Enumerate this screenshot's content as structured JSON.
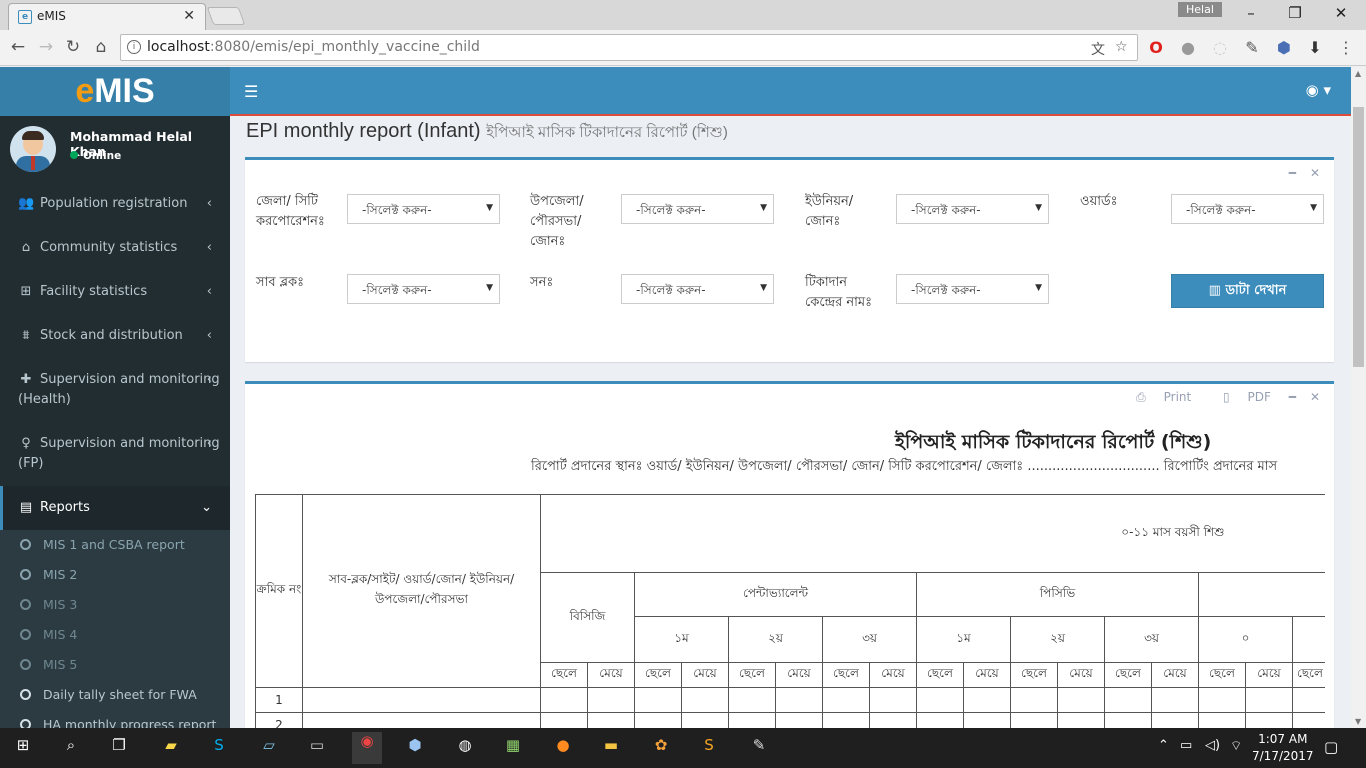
{
  "browser": {
    "tab_title": "eMIS",
    "tab_favicon": "e",
    "profile_name": "Helal",
    "url_host": "localhost",
    "url_path": ":8080/emis/epi_monthly_vaccine_child"
  },
  "app": {
    "logo_prefix": "e",
    "logo_rest": "MIS",
    "user_name": "Mohammad Helal Khan",
    "user_status": "Online"
  },
  "sidebar": {
    "items": [
      {
        "label": "Population registration",
        "icon": "users-icon"
      },
      {
        "label": "Community statistics",
        "icon": "home-icon"
      },
      {
        "label": "Facility statistics",
        "icon": "medkit-icon"
      },
      {
        "label": "Stock and distribution",
        "icon": "cubes-icon"
      },
      {
        "label": "Supervision and monitoring (Health)",
        "icon": "plus-icon"
      },
      {
        "label": "Supervision and monitoring (FP)",
        "icon": "female-icon"
      },
      {
        "label": "Reports",
        "icon": "report-icon"
      }
    ],
    "sub_items": [
      "MIS 1 and CSBA report",
      "MIS 2",
      "MIS 3",
      "MIS 4",
      "MIS 5",
      "Daily tally sheet for FWA",
      "HA monthly progress report"
    ]
  },
  "page": {
    "title": "EPI monthly report (Infant)",
    "title_bn": "ইপিআই মাসিক টিকাদানের রিপোর্ট (শিশু)"
  },
  "filters": {
    "zilla_label": "জেলা/ সিটি করপোরেশনঃ",
    "upazila_label": "উপজেলা/ পৌরসভা/ জোনঃ",
    "union_label": "ইউনিয়ন/ জোনঃ",
    "ward_label": "ওয়ার্ডঃ",
    "subblock_label": "সাব ব্লকঃ",
    "year_label": "সনঃ",
    "center_label": "টিকাদান কেন্দ্রের নামঃ",
    "select_placeholder": "-সিলেক্ট করুন-",
    "show_button": "ডাটা দেখান"
  },
  "report": {
    "print_label": "Print",
    "pdf_label": "PDF",
    "heading": "ইপিআই মাসিক টিকাদানের রিপোর্ট (শিশু)",
    "subheading": "রিপোর্ট প্রদানের স্থানঃ ওয়ার্ড/ ইউনিয়ন/ উপজেলা/ পৌরসভা/ জোন/ সিটি করপোরেশন/ জেলাঃ ................................ রিপোর্টিং প্রদানের মাস",
    "col_serial": "ক্রমিক নং",
    "col_location": "সাব-ব্লক/সাইট/ ওয়ার্ড/জোন/ ইউনিয়ন/ উপজেলা/পৌরসভা",
    "group_header": "০-১১ মাস বয়সী শিশু",
    "col_bcg": "বিসিজি",
    "col_penta": "পেন্টাভ্যালেন্ট",
    "col_pcv": "পিসিভি",
    "dose_1": "১ম",
    "dose_2": "২য়",
    "dose_3": "৩য়",
    "dose_0": "০",
    "boy": "ছেলে",
    "girl": "মেয়ে",
    "rows": [
      "1",
      "2"
    ]
  },
  "taskbar": {
    "time": "1:07 AM",
    "date": "7/17/2017"
  }
}
